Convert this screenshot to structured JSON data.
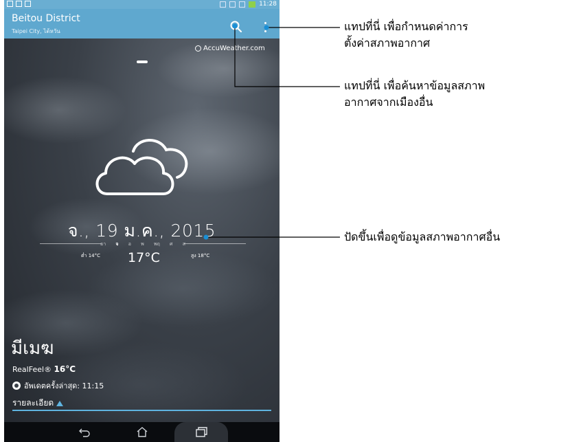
{
  "status_bar": {
    "time": "11:28"
  },
  "app_bar": {
    "title": "Beitou District",
    "subtitle": "Taipei City, ไต้หวัน"
  },
  "provider": "AccuWeather.com",
  "weather": {
    "date": "จ., 19 ม.ค., 2015",
    "days": [
      "อา",
      "จ",
      "อ",
      "พ",
      "พฤ",
      "ศ",
      "ส"
    ],
    "active_day_index": 1,
    "low": "ต่ำ 14°C",
    "high": "สูง 18°C",
    "temperature": "17°C",
    "condition": "มีเมฆ",
    "realfeel_label": "RealFeel®",
    "realfeel_value": "16°C",
    "updated": "อัพเดตครั้งล่าสุด: 11:15",
    "details_label": "รายละเอียด"
  },
  "annotations": [
    {
      "text_line1": "แทปที่นี่ เพื่อกำหนดค่าการ",
      "text_line2": "ตั้งค่าสภาพอากาศ"
    },
    {
      "text_line1": "แทปที่นี่ เพื่อค้นหาข้อมูลสภาพ",
      "text_line2": "อากาศจากเมืองอื่น"
    },
    {
      "text_line1": "ปัดขึ้นเพื่อดูข้อมูลสภาพอากาศอื่น"
    }
  ],
  "colors": {
    "appbar": "#5fa8cf",
    "accent": "#5fb4e0",
    "navbar": "#0a0c0f"
  }
}
